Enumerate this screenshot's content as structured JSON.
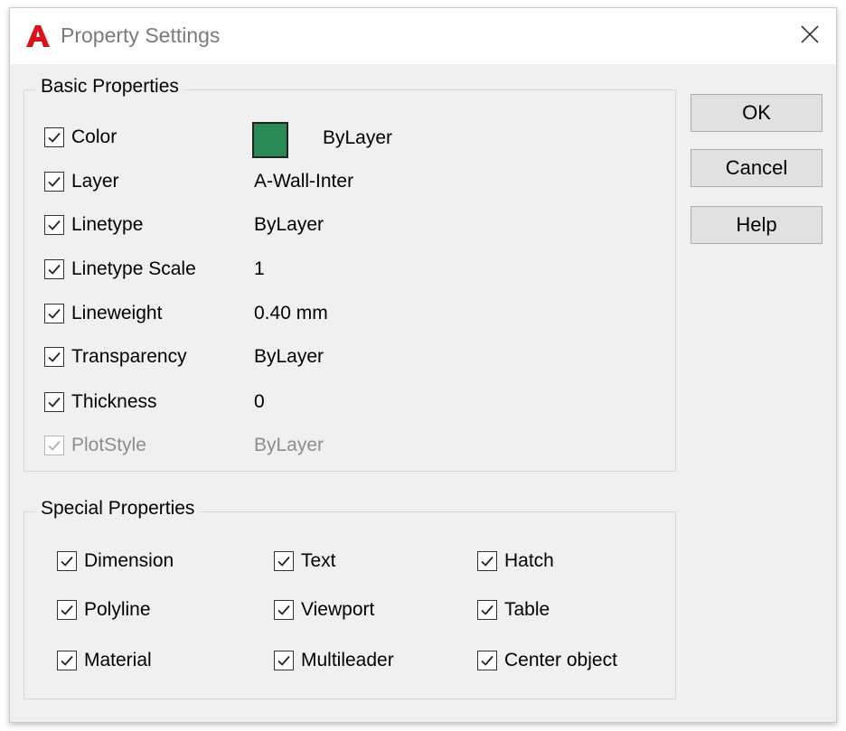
{
  "window": {
    "title": "Property Settings",
    "app_icon": "autocad-logo-icon",
    "close_icon": "close-icon"
  },
  "basic": {
    "title": "Basic Properties",
    "swatch_color": "#2a8a55",
    "rows": [
      {
        "label": "Color",
        "value": "ByLayer",
        "checked": true,
        "enabled": true
      },
      {
        "label": "Layer",
        "value": "A-Wall-Inter",
        "checked": true,
        "enabled": true
      },
      {
        "label": "Linetype",
        "value": "ByLayer",
        "checked": true,
        "enabled": true
      },
      {
        "label": "Linetype Scale",
        "value": "1",
        "checked": true,
        "enabled": true
      },
      {
        "label": "Lineweight",
        "value": "0.40 mm",
        "checked": true,
        "enabled": true
      },
      {
        "label": "Transparency",
        "value": "ByLayer",
        "checked": true,
        "enabled": true
      },
      {
        "label": "Thickness",
        "value": "0",
        "checked": true,
        "enabled": true
      },
      {
        "label": "PlotStyle",
        "value": "ByLayer",
        "checked": true,
        "enabled": false
      }
    ]
  },
  "special": {
    "title": "Special Properties",
    "items": [
      {
        "label": "Dimension",
        "checked": true
      },
      {
        "label": "Text",
        "checked": true
      },
      {
        "label": "Hatch",
        "checked": true
      },
      {
        "label": "Polyline",
        "checked": true
      },
      {
        "label": "Viewport",
        "checked": true
      },
      {
        "label": "Table",
        "checked": true
      },
      {
        "label": "Material",
        "checked": true
      },
      {
        "label": "Multileader",
        "checked": true
      },
      {
        "label": "Center object",
        "checked": true
      }
    ]
  },
  "buttons": {
    "ok": "OK",
    "cancel": "Cancel",
    "help": "Help"
  }
}
